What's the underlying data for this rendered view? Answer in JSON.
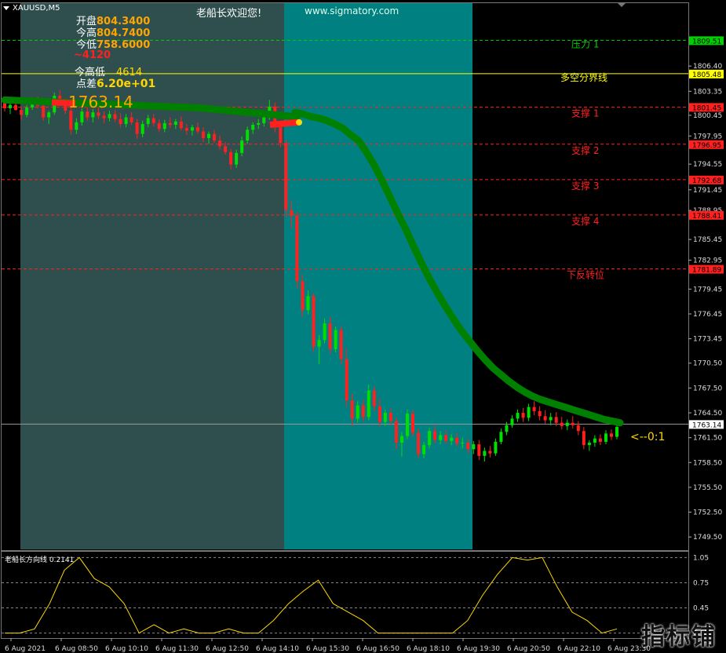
{
  "window": {
    "symbol": "XAUUSD,M5"
  },
  "header": {
    "welcome": "老船长欢迎您!",
    "website": "www.sigmatory.com"
  },
  "info_panel": {
    "open_label": "开盘",
    "open_value": "804.3400",
    "high_label": "今高",
    "high_value": "804.7400",
    "low_label": "今低",
    "low_value": "758.6000",
    "change_text": "~4120",
    "range_label": "今高低",
    "range_value": "4614",
    "points_label": "点差",
    "points_value": "6.20e+01"
  },
  "current_price_label": "1763.14",
  "levels": [
    {
      "name": "压力 1",
      "price": "1809.51",
      "color": "#00d000"
    },
    {
      "name": "多空分界线",
      "price": "1805.48",
      "color": "#ffff00"
    },
    {
      "name": "支撑 1",
      "price": "1801.45",
      "color": "#ff2020"
    },
    {
      "name": "支撑 2",
      "price": "1796.95",
      "color": "#ff2020"
    },
    {
      "name": "支撑 3",
      "price": "1792.68",
      "color": "#ff2020"
    },
    {
      "name": "支撑 4",
      "price": "1788.41",
      "color": "#ff2020"
    },
    {
      "name": "下反转位",
      "price": "1781.89",
      "color": "#ff2020"
    }
  ],
  "current_price_tag": "1763.14",
  "ratio_text": "<--0:1",
  "price_axis": [
    "1806.40",
    "1803.35",
    "1800.45",
    "1797.95",
    "1794.55",
    "1791.45",
    "1788.95",
    "1785.45",
    "1782.95",
    "1779.45",
    "1776.45",
    "1773.45",
    "1770.50",
    "1767.50",
    "1764.50",
    "1761.50",
    "1758.50",
    "1755.50",
    "1752.50",
    "1749.50"
  ],
  "time_axis": [
    "6 Aug 2021",
    "6 Aug 08:50",
    "6 Aug 10:10",
    "6 Aug 11:30",
    "6 Aug 12:50",
    "6 Aug 14:10",
    "6 Aug 15:30",
    "6 Aug 16:50",
    "6 Aug 18:10",
    "6 Aug 19:30",
    "6 Aug 20:50",
    "6 Aug 22:10",
    "6 Aug 23:30"
  ],
  "indicator": {
    "title": "老船长方向线 0.2141",
    "ticks": [
      "1.05",
      "0.75",
      "0.45",
      "0.15"
    ]
  },
  "watermark": "指标铺",
  "colors": {
    "bull": "#00e000",
    "bear": "#ff2020",
    "ma": "#008000",
    "zone1": "#2f4f4f",
    "zone2": "#008080",
    "ind_line": "#ffd700"
  },
  "chart_data": {
    "type": "candlestick",
    "price_range": [
      1748,
      1814
    ],
    "candles": [
      [
        1802.0,
        1802.6,
        1800.9,
        1801.3
      ],
      [
        1801.3,
        1801.9,
        1800.6,
        1801.7
      ],
      [
        1801.7,
        1802.2,
        1801.0,
        1801.1
      ],
      [
        1801.1,
        1801.5,
        1799.9,
        1800.5
      ],
      [
        1800.5,
        1801.7,
        1800.2,
        1801.4
      ],
      [
        1801.4,
        1802.6,
        1801.1,
        1802.3
      ],
      [
        1802.3,
        1802.7,
        1801.3,
        1801.6
      ],
      [
        1801.6,
        1801.9,
        1799.8,
        1800.2
      ],
      [
        1800.2,
        1801.0,
        1799.4,
        1800.8
      ],
      [
        1800.8,
        1803.2,
        1800.5,
        1802.8
      ],
      [
        1802.8,
        1803.5,
        1801.9,
        1802.2
      ],
      [
        1802.2,
        1802.5,
        1800.6,
        1801.0
      ],
      [
        1801.0,
        1801.6,
        1798.1,
        1798.7
      ],
      [
        1798.7,
        1800.1,
        1798.2,
        1799.6
      ],
      [
        1799.6,
        1801.3,
        1799.2,
        1800.9
      ],
      [
        1800.9,
        1801.4,
        1799.8,
        1800.2
      ],
      [
        1800.2,
        1801.2,
        1799.6,
        1800.8
      ],
      [
        1800.8,
        1801.5,
        1800.0,
        1800.4
      ],
      [
        1800.4,
        1800.9,
        1799.5,
        1800.1
      ],
      [
        1800.1,
        1801.0,
        1799.7,
        1800.6
      ],
      [
        1800.6,
        1801.1,
        1799.6,
        1800.0
      ],
      [
        1800.0,
        1800.7,
        1799.0,
        1799.4
      ],
      [
        1799.4,
        1800.6,
        1799.0,
        1800.2
      ],
      [
        1800.2,
        1800.8,
        1799.3,
        1799.6
      ],
      [
        1799.6,
        1800.0,
        1797.6,
        1798.2
      ],
      [
        1798.2,
        1799.8,
        1797.8,
        1799.4
      ],
      [
        1799.4,
        1800.5,
        1799.0,
        1800.1
      ],
      [
        1800.1,
        1800.6,
        1799.1,
        1799.5
      ],
      [
        1799.5,
        1800.0,
        1798.4,
        1798.8
      ],
      [
        1798.8,
        1799.9,
        1798.4,
        1799.5
      ],
      [
        1799.5,
        1800.2,
        1798.9,
        1799.3
      ],
      [
        1799.3,
        1800.0,
        1798.8,
        1799.7
      ],
      [
        1799.7,
        1800.3,
        1798.6,
        1798.9
      ],
      [
        1798.9,
        1799.4,
        1798.1,
        1798.6
      ],
      [
        1798.6,
        1799.3,
        1798.0,
        1799.0
      ],
      [
        1799.0,
        1799.6,
        1798.2,
        1798.5
      ],
      [
        1798.5,
        1799.0,
        1797.2,
        1797.7
      ],
      [
        1797.7,
        1798.5,
        1797.0,
        1798.2
      ],
      [
        1798.2,
        1798.7,
        1797.1,
        1797.4
      ],
      [
        1797.4,
        1798.0,
        1796.3,
        1796.7
      ],
      [
        1796.7,
        1797.2,
        1795.7,
        1796.0
      ],
      [
        1796.0,
        1796.4,
        1793.9,
        1794.5
      ],
      [
        1794.5,
        1796.3,
        1794.1,
        1795.9
      ],
      [
        1795.9,
        1797.9,
        1795.5,
        1797.4
      ],
      [
        1797.4,
        1799.1,
        1797.0,
        1798.7
      ],
      [
        1798.7,
        1799.6,
        1798.2,
        1799.3
      ],
      [
        1799.3,
        1800.0,
        1798.8,
        1799.5
      ],
      [
        1799.5,
        1800.5,
        1799.1,
        1800.2
      ],
      [
        1800.2,
        1802.3,
        1799.9,
        1801.5
      ],
      [
        1801.5,
        1802.0,
        1798.4,
        1799.0
      ],
      [
        1799.0,
        1799.4,
        1796.6,
        1797.1
      ],
      [
        1797.1,
        1797.5,
        1788.2,
        1789.0
      ],
      [
        1789.0,
        1790.2,
        1786.8,
        1788.3
      ],
      [
        1788.3,
        1788.8,
        1779.5,
        1780.4
      ],
      [
        1780.4,
        1781.2,
        1776.1,
        1776.9
      ],
      [
        1776.9,
        1779.3,
        1776.4,
        1778.6
      ],
      [
        1778.6,
        1779.0,
        1771.8,
        1772.5
      ],
      [
        1772.5,
        1773.9,
        1770.4,
        1773.3
      ],
      [
        1773.3,
        1775.9,
        1772.9,
        1775.3
      ],
      [
        1775.3,
        1776.1,
        1771.6,
        1772.2
      ],
      [
        1772.2,
        1774.9,
        1771.8,
        1774.5
      ],
      [
        1774.5,
        1775.0,
        1770.3,
        1771.0
      ],
      [
        1771.0,
        1772.3,
        1765.2,
        1766.0
      ],
      [
        1766.0,
        1766.8,
        1762.9,
        1763.8
      ],
      [
        1763.8,
        1765.9,
        1763.3,
        1765.4
      ],
      [
        1765.4,
        1766.1,
        1763.4,
        1764.0
      ],
      [
        1764.0,
        1767.9,
        1763.6,
        1767.2
      ],
      [
        1767.2,
        1767.7,
        1764.7,
        1765.3
      ],
      [
        1765.3,
        1766.2,
        1762.8,
        1763.4
      ],
      [
        1763.4,
        1764.9,
        1762.9,
        1764.5
      ],
      [
        1764.5,
        1765.1,
        1763.0,
        1763.5
      ],
      [
        1763.5,
        1764.0,
        1760.1,
        1760.9
      ],
      [
        1760.9,
        1762.2,
        1759.2,
        1761.7
      ],
      [
        1761.7,
        1764.9,
        1761.3,
        1764.4
      ],
      [
        1764.4,
        1764.9,
        1761.6,
        1762.1
      ],
      [
        1762.1,
        1762.6,
        1759.0,
        1759.5
      ],
      [
        1759.5,
        1761.0,
        1759.0,
        1760.6
      ],
      [
        1760.6,
        1762.7,
        1760.2,
        1762.3
      ],
      [
        1762.3,
        1763.0,
        1760.8,
        1761.2
      ],
      [
        1761.2,
        1762.3,
        1760.7,
        1761.8
      ],
      [
        1761.8,
        1762.4,
        1760.7,
        1761.1
      ],
      [
        1761.1,
        1761.9,
        1760.6,
        1761.5
      ],
      [
        1761.5,
        1762.1,
        1760.4,
        1760.8
      ],
      [
        1760.8,
        1761.5,
        1760.2,
        1760.9
      ],
      [
        1760.9,
        1761.4,
        1759.6,
        1760.1
      ],
      [
        1760.1,
        1761.1,
        1759.5,
        1760.7
      ],
      [
        1760.7,
        1761.2,
        1758.8,
        1759.3
      ],
      [
        1759.3,
        1760.3,
        1758.6,
        1759.9
      ],
      [
        1759.9,
        1760.5,
        1759.1,
        1759.6
      ],
      [
        1759.6,
        1761.4,
        1759.3,
        1761.0
      ],
      [
        1761.0,
        1762.6,
        1760.7,
        1762.2
      ],
      [
        1762.2,
        1763.4,
        1761.8,
        1763.0
      ],
      [
        1763.0,
        1764.2,
        1762.7,
        1763.8
      ],
      [
        1763.8,
        1764.9,
        1763.4,
        1764.5
      ],
      [
        1764.5,
        1765.1,
        1763.4,
        1763.9
      ],
      [
        1763.9,
        1765.6,
        1763.5,
        1765.2
      ],
      [
        1765.2,
        1765.9,
        1764.2,
        1764.7
      ],
      [
        1764.7,
        1765.3,
        1763.6,
        1764.1
      ],
      [
        1764.1,
        1764.8,
        1763.2,
        1763.6
      ],
      [
        1763.6,
        1764.5,
        1763.0,
        1764.0
      ],
      [
        1764.0,
        1764.6,
        1762.9,
        1763.3
      ],
      [
        1763.3,
        1764.0,
        1762.5,
        1762.9
      ],
      [
        1762.9,
        1763.7,
        1762.4,
        1763.3
      ],
      [
        1763.3,
        1764.1,
        1762.6,
        1763.0
      ],
      [
        1763.0,
        1763.5,
        1761.8,
        1762.3
      ],
      [
        1762.3,
        1762.8,
        1760.1,
        1760.6
      ],
      [
        1760.6,
        1761.2,
        1759.9,
        1760.9
      ],
      [
        1760.9,
        1761.8,
        1760.4,
        1761.4
      ],
      [
        1761.4,
        1761.9,
        1760.6,
        1761.0
      ],
      [
        1761.0,
        1762.4,
        1760.7,
        1762.0
      ],
      [
        1762.0,
        1762.5,
        1761.2,
        1761.6
      ],
      [
        1761.6,
        1763.2,
        1761.3,
        1762.8
      ]
    ],
    "ma": [
      1800.8,
      1800.6,
      1800.3,
      1800.1,
      1799.8,
      1799.4,
      1798.9,
      1798.1,
      1797.4,
      1796.0,
      1794.4,
      1792.5,
      1790.5,
      1788.5,
      1786.6,
      1784.5,
      1782.5,
      1780.6,
      1778.9,
      1777.3,
      1775.8,
      1774.4,
      1773.2,
      1772.0,
      1770.9,
      1769.9,
      1769.1,
      1768.3,
      1767.6,
      1767.0,
      1766.5,
      1766.1,
      1765.8,
      1765.5,
      1765.2,
      1764.9,
      1764.6,
      1764.3,
      1764.0,
      1763.7,
      1763.5,
      1763.3
    ],
    "indicator_values": [
      0.15,
      0.15,
      0.2,
      0.5,
      0.9,
      1.05,
      0.8,
      0.7,
      0.5,
      0.15,
      0.25,
      0.15,
      0.2,
      0.15,
      0.15,
      0.2,
      0.15,
      0.15,
      0.3,
      0.5,
      0.65,
      0.78,
      0.5,
      0.4,
      0.3,
      0.15,
      0.15,
      0.15,
      0.15,
      0.15,
      0.15,
      0.3,
      0.6,
      0.85,
      1.05,
      1.02,
      1.05,
      0.7,
      0.4,
      0.3,
      0.15,
      0.2
    ]
  }
}
